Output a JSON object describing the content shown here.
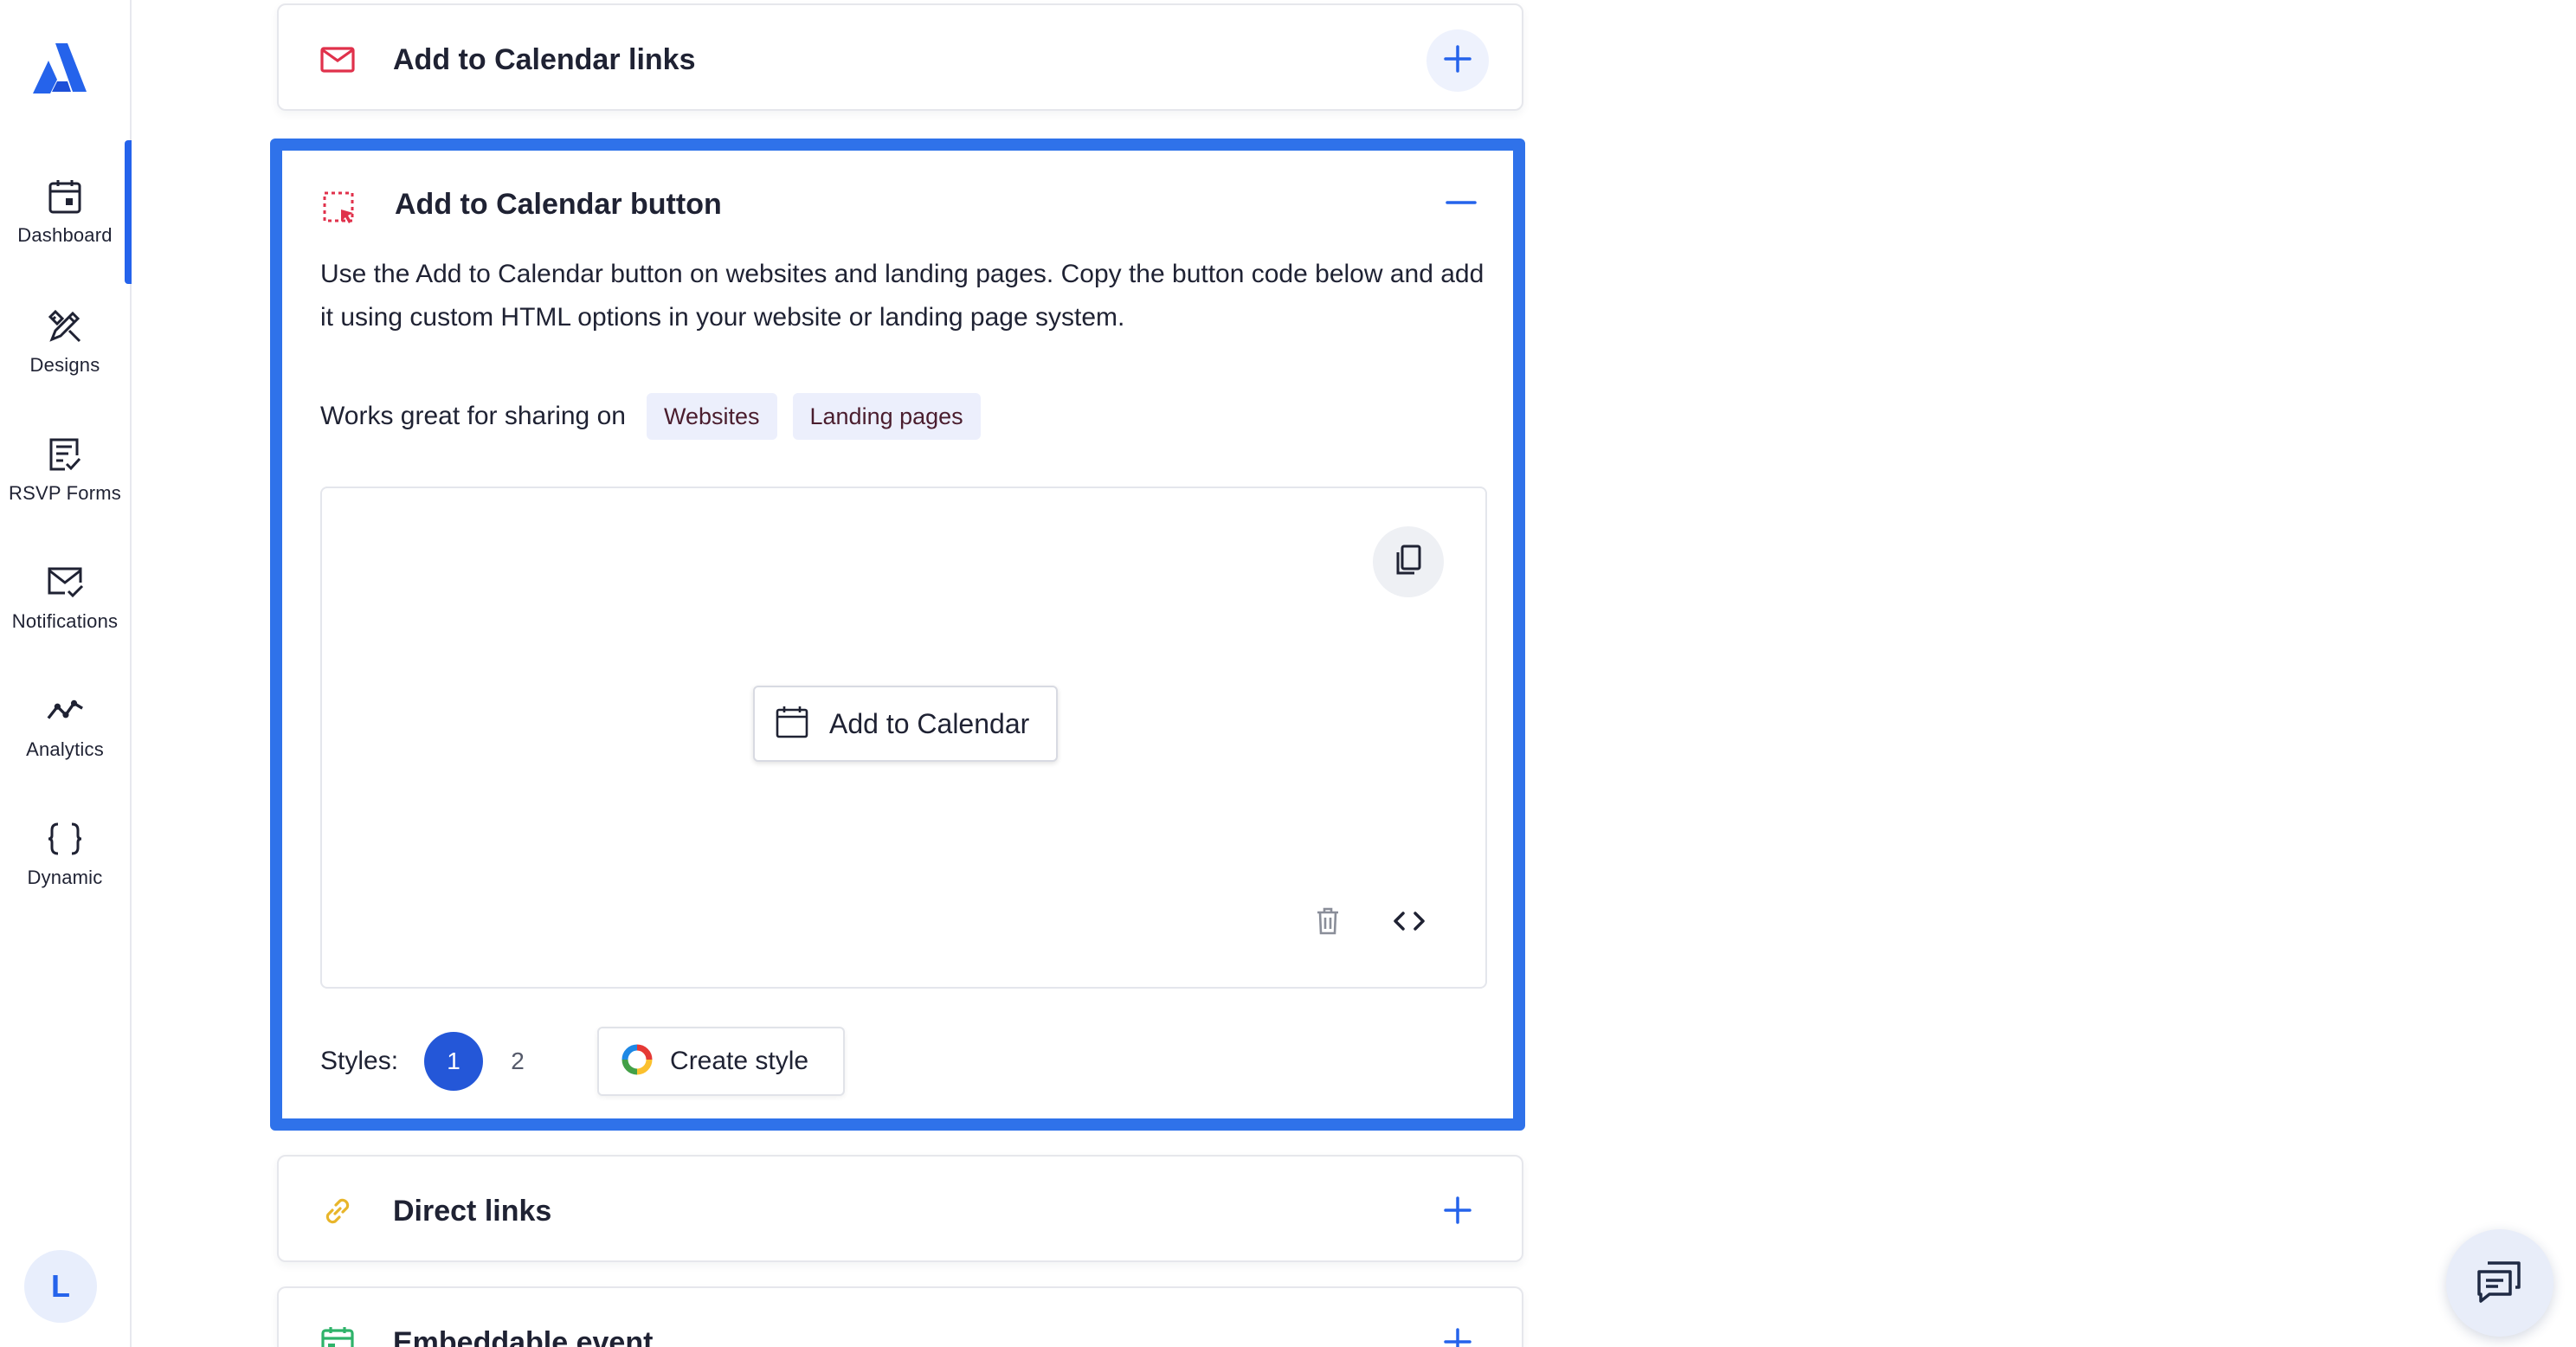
{
  "sidebar": {
    "items": [
      {
        "label": "Dashboard",
        "icon": "calendar-icon",
        "active": true
      },
      {
        "label": "Designs",
        "icon": "design-tools-icon",
        "active": false
      },
      {
        "label": "RSVP Forms",
        "icon": "form-check-icon",
        "active": false
      },
      {
        "label": "Notifications",
        "icon": "mail-check-icon",
        "active": false
      },
      {
        "label": "Analytics",
        "icon": "trend-line-icon",
        "active": false
      },
      {
        "label": "Dynamic",
        "icon": "curly-braces-icon",
        "active": false
      }
    ],
    "avatar_initial": "L"
  },
  "cards": {
    "links": {
      "title": "Add to Calendar links",
      "icon": "mail-icon"
    },
    "button": {
      "title": "Add to Calendar button",
      "icon": "select-cursor-icon",
      "description": "Use the Add to Calendar button on websites and landing pages. Copy the button code below and add it using custom HTML options in your website or landing page system.",
      "works_label": "Works great for sharing on",
      "tags": [
        "Websites",
        "Landing pages"
      ],
      "preview_button_label": "Add to Calendar",
      "styles_label": "Styles:",
      "styles": [
        "1",
        "2"
      ],
      "create_style_label": "Create style"
    },
    "direct": {
      "title": "Direct links",
      "icon": "link-icon"
    },
    "embed": {
      "title": "Embeddable event",
      "icon": "calendar-green-icon"
    }
  },
  "colors": {
    "accent": "#2563eb",
    "expanded_border": "#2f72ea",
    "tag_bg": "#eceffc",
    "mail_icon": "#e0314b",
    "link_icon": "#e8b52a",
    "embed_icon": "#2fb36a"
  }
}
